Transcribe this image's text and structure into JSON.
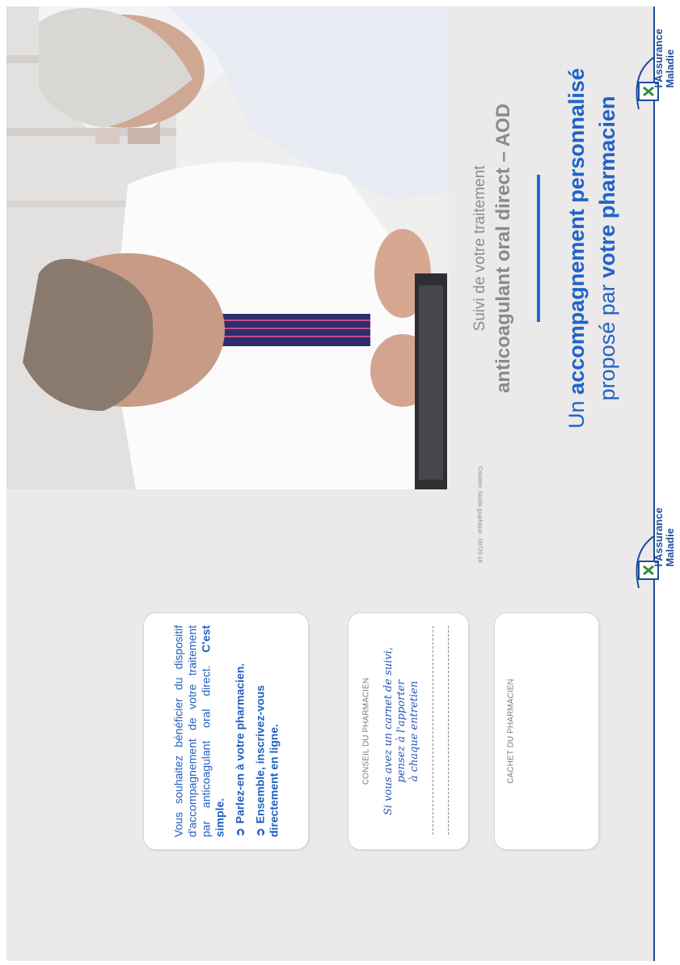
{
  "cover": {
    "kicker": "Suivi de votre traitement",
    "product": "anticoagulant oral direct – AOD",
    "headline_line1_a": "Un ",
    "headline_line1_b": "accompagnement personnalisé",
    "headline_line2_a": "proposé par ",
    "headline_line2_b": "votre pharmacien"
  },
  "logo": {
    "line1": "l'Assurance",
    "line2": "Maladie"
  },
  "credit": "Création: Studio graphique - 00720-18",
  "info_panel": {
    "intro": "Vous souhaitez bénéficier du dispositif d'accompagnement de votre traitement par anticoagulant oral direct. ",
    "intro_bold": "C'est simple.",
    "bullet1": "Parlez-en à votre pharmacien.",
    "bullet2_line1": "Ensemble, inscrivez-vous",
    "bullet2_line2": "directement en ligne.",
    "bullet_symbol": "➲"
  },
  "advice_panel": {
    "label": "CONSEIL DU PHARMACIEN",
    "line1": "Si vous avez un carnet de suivi,",
    "line2": "pensez à l'apporter",
    "line3": "à chaque entretien"
  },
  "stamp_panel": {
    "label": "CACHET DU PHARMACIEN"
  },
  "colors": {
    "brand_blue": "#1f63c7",
    "rail_blue": "#1b4c9a",
    "paper": "#ebe9ea"
  }
}
